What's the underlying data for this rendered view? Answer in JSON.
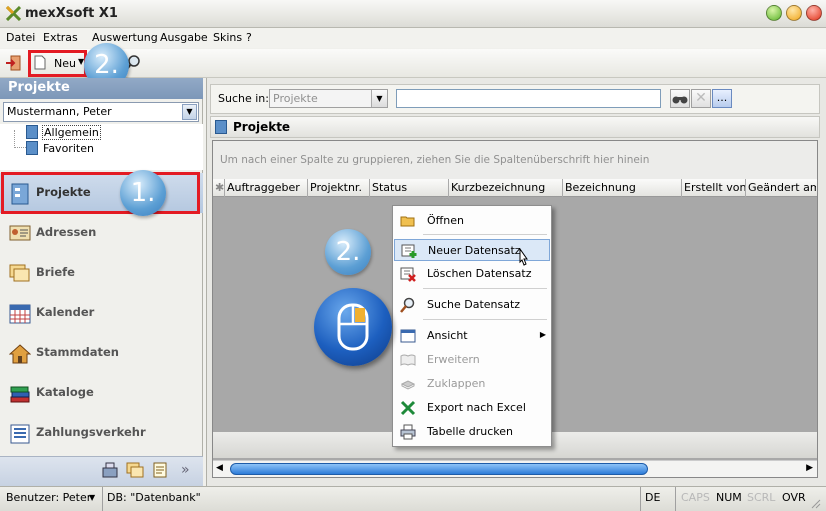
{
  "window": {
    "title": "mexXsoft X1"
  },
  "menubar": {
    "items": [
      "Datei",
      "Extras",
      "Auswertung",
      "Ausgabe",
      "Skins",
      "?"
    ]
  },
  "toolbar": {
    "new_label": "Neu"
  },
  "sidebar": {
    "header": "Projekte",
    "user_select": "Mustermann, Peter",
    "tree": [
      "Allgemein",
      "Favoriten"
    ],
    "nav": [
      "Projekte",
      "Adressen",
      "Briefe",
      "Kalender",
      "Stammdaten",
      "Kataloge",
      "Zahlungsverkehr"
    ]
  },
  "search": {
    "label": "Suche in:",
    "scope_placeholder": "Projekte",
    "button_more": "..."
  },
  "panel": {
    "title": "Projekte"
  },
  "grid": {
    "group_hint": "Um nach einer Spalte zu gruppieren, ziehen Sie die Spaltenüberschrift hier hinein",
    "columns": [
      "Auftraggeber",
      "Projektnr.",
      "Status",
      "Kurzbezeichnung",
      "Bezeichnung",
      "Erstellt von",
      "Geändert am"
    ]
  },
  "context_menu": {
    "items": [
      "Öffnen",
      "Neuer Datensatz",
      "Löschen Datensatz",
      "Suche Datensatz",
      "Ansicht",
      "Erweitern",
      "Zuklappen",
      "Export nach Excel",
      "Tabelle drucken"
    ]
  },
  "annotations": {
    "step1": "1.",
    "step2": "2."
  },
  "statusbar": {
    "user": "Benutzer: Peter",
    "db": "DB: \"Datenbank\"",
    "lang": "DE",
    "caps": "CAPS",
    "num": "NUM",
    "scrl": "SCRL",
    "ovr": "OVR"
  },
  "colors": {
    "accent_red": "#e31b23",
    "header_blue": "#7d97b8",
    "selection_blue": "#dbe8f7"
  }
}
